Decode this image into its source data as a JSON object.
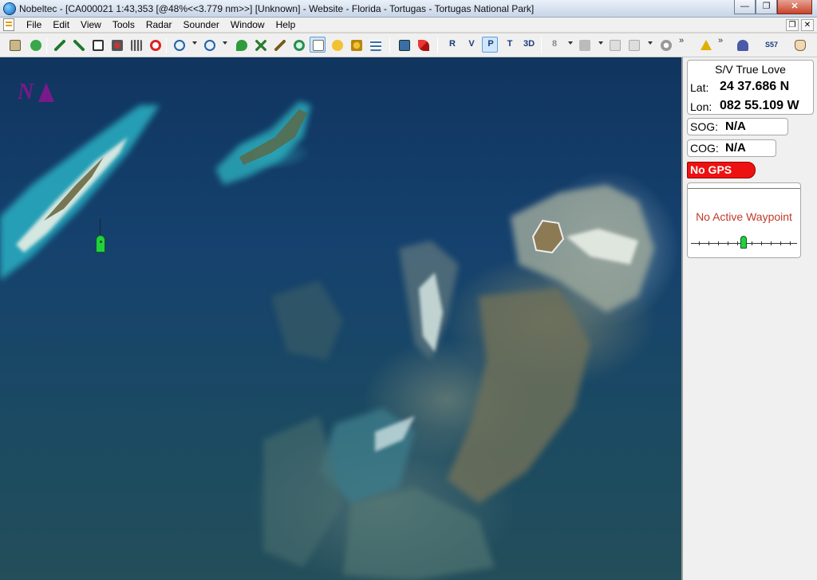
{
  "window": {
    "title": "Nobeltec - [CA000021 1:43,353 [@48%<<3.779 nm>>] [Unknown] - Website - Florida - Tortugas - Tortugas National Park]",
    "minimize": "—",
    "restore": "❐",
    "close": "✕"
  },
  "menu": {
    "items": [
      "File",
      "Edit",
      "View",
      "Tools",
      "Radar",
      "Sounder",
      "Window",
      "Help"
    ],
    "restore": "❐",
    "close": "✕"
  },
  "toolbar": {
    "chevron": "»",
    "text_buttons": [
      "R",
      "V",
      "P",
      "T",
      "3D",
      "8",
      "S57"
    ]
  },
  "chart": {
    "north_label": "N"
  },
  "panel": {
    "vessel_name": "S/V True Love",
    "lat_label": "Lat:",
    "lat_value": "24 37.686 N",
    "lon_label": "Lon:",
    "lon_value": "082 55.109 W",
    "sog_label": "SOG:",
    "sog_value": "N/A",
    "cog_label": "COG:",
    "cog_value": "N/A",
    "gps_status": "No GPS",
    "waypoint_status": "No Active Waypoint"
  },
  "colors": {
    "north_arrow": "#7a1a8a",
    "vessel": "#22d040",
    "gps_alert": "#ee1111",
    "waypoint_text": "#c23a2a"
  }
}
